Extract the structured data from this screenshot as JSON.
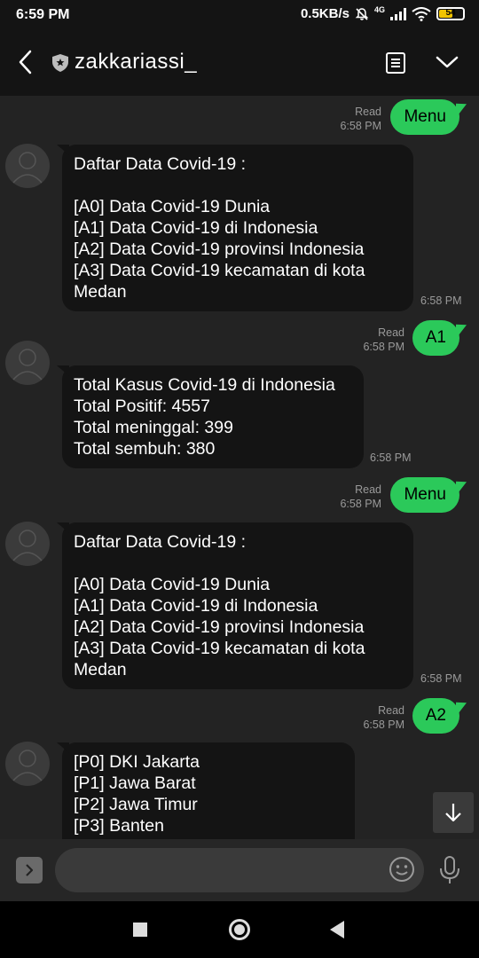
{
  "status_bar": {
    "time": "6:59 PM",
    "speed": "0.5KB/s",
    "network": "4G",
    "battery": "54",
    "battery_level": 0.54
  },
  "header": {
    "title": "zakkariassi_"
  },
  "messages": [
    {
      "type": "out",
      "read": "Read",
      "time": "6:58 PM",
      "text": "Menu"
    },
    {
      "type": "in",
      "time": "6:58 PM",
      "text": "Daftar Data Covid-19 :\n\n[A0] Data Covid-19 Dunia\n[A1] Data Covid-19 di Indonesia\n[A2] Data Covid-19 provinsi Indonesia\n[A3] Data Covid-19 kecamatan di kota Medan"
    },
    {
      "type": "out",
      "read": "Read",
      "time": "6:58 PM",
      "text": "A1"
    },
    {
      "type": "in",
      "time": "6:58 PM",
      "text": "Total Kasus Covid-19 di Indonesia\nTotal Positif: 4557\nTotal meninggal: 399\nTotal sembuh: 380"
    },
    {
      "type": "out",
      "read": "Read",
      "time": "6:58 PM",
      "text": "Menu"
    },
    {
      "type": "in",
      "time": "6:58 PM",
      "text": "Daftar Data Covid-19 :\n\n[A0] Data Covid-19 Dunia\n[A1] Data Covid-19 di Indonesia\n[A2] Data Covid-19 provinsi Indonesia\n[A3] Data Covid-19 kecamatan di kota Medan"
    },
    {
      "type": "out",
      "read": "Read",
      "time": "6:58 PM",
      "text": "A2"
    },
    {
      "type": "in",
      "time": "",
      "text": "[P0] DKI Jakarta\n[P1] Jawa Barat\n[P2] Jawa Timur\n[P3] Banten"
    }
  ],
  "input": {
    "placeholder": ""
  },
  "colors": {
    "accent": "#2bc95a",
    "header_bg": "#141414",
    "chat_bg": "#232323",
    "bubble_in": "#141414"
  }
}
